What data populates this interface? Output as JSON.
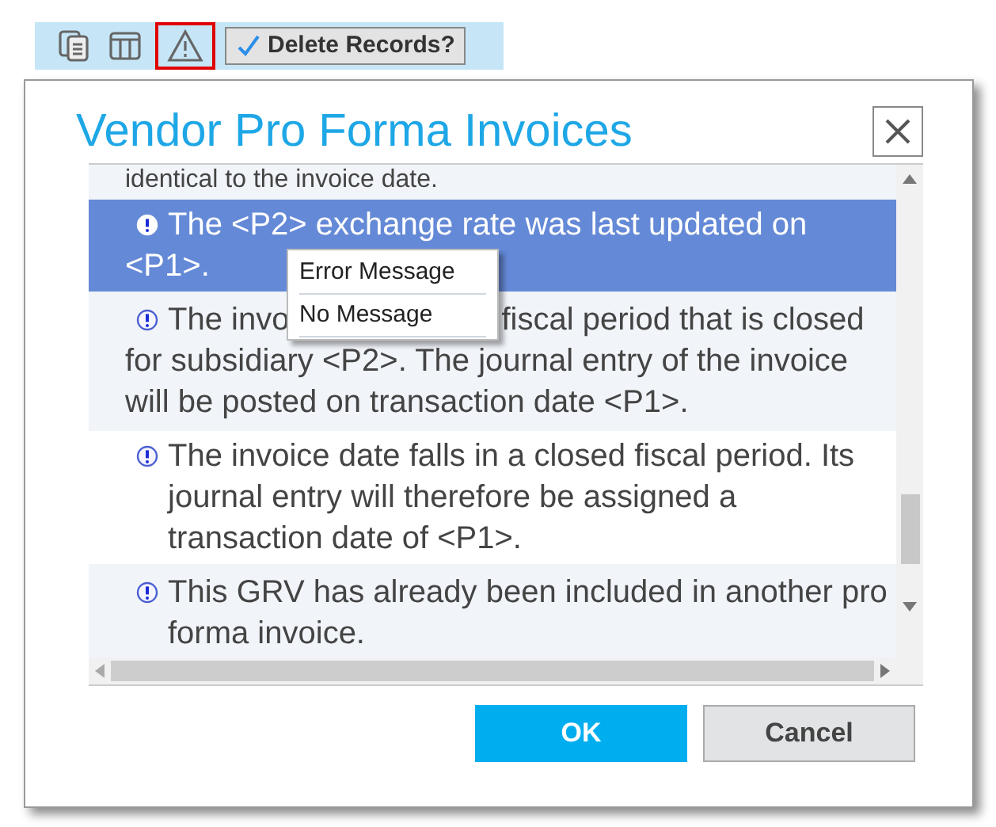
{
  "toolbar": {
    "tools": [
      {
        "kind": "copy",
        "selected": false
      },
      {
        "kind": "columns",
        "selected": false
      },
      {
        "kind": "warning",
        "selected": true
      }
    ],
    "delete_button": "Delete Records?"
  },
  "dialog": {
    "title": "Vendor Pro Forma Invoices",
    "messages": [
      {
        "kind": "plain",
        "text": "identical to the invoice date.",
        "selected": false
      },
      {
        "kind": "covered",
        "text": "The <P2> exchange rate was last updated on",
        "rest": "<P1>.",
        "selected": true
      },
      {
        "kind": "covered",
        "text": "The invo",
        "text_after": "fiscal period that is closed",
        "rest": "for subsidiary <P2>. The journal entry of the invoice will be posted on transaction date <P1>.",
        "selected": false
      },
      {
        "kind": "info",
        "text": "The invoice date falls in a closed fiscal period. Its journal entry will therefore be assigned a transaction date of <P1>.",
        "selected": false
      },
      {
        "kind": "info",
        "text": "This GRV has already been included in another pro forma invoice.",
        "selected": false
      }
    ],
    "context_menu": [
      "Error Message",
      "No Message"
    ],
    "buttons": [
      {
        "kind": "primary",
        "label": "OK"
      },
      {
        "kind": "secondary",
        "label": "Cancel"
      }
    ]
  }
}
